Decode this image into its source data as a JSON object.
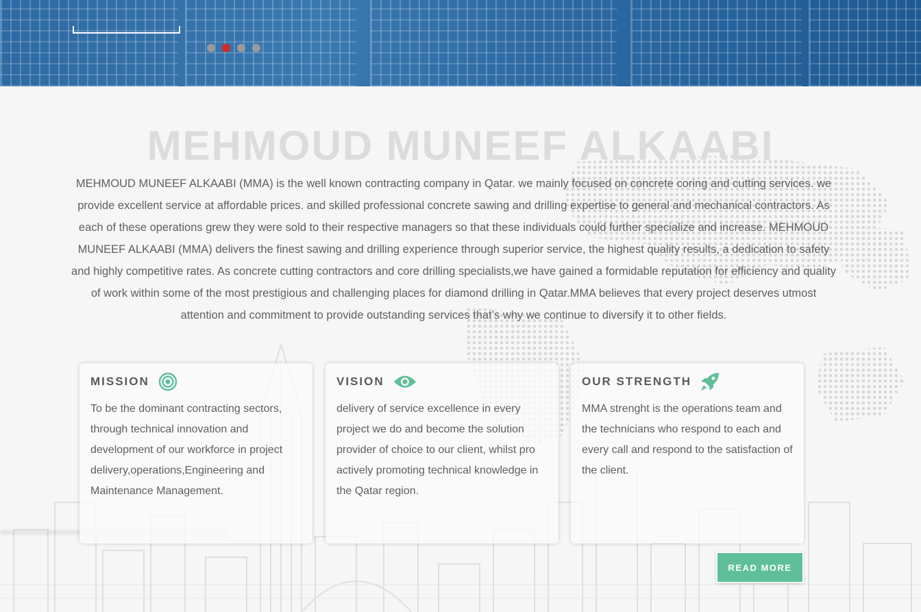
{
  "hero": {
    "slides": 4,
    "active_slide": 2
  },
  "about": {
    "title": "MEHMOUD MUNEEF ALKAABI",
    "description": "MEHMOUD MUNEEF ALKAABI (MMA) is the well known contracting company in Qatar. we mainly focused on concrete coring and cutting services. we provide excellent service at affordable prices. and skilled professional concrete sawing and drilling expertise to general and mechanical contractors. As each of these operations grew they were sold to their respective managers so that these individuals could further specialize and increase. MEHMOUD MUNEEF ALKAABI (MMA) delivers the finest sawing and drilling experience through superior service, the highest quality results, a dedication to safety and highly competitive rates. As concrete cutting contractors and core drilling specialists,we have gained a formidable reputation for efficiency and quality of work within some of the most prestigious and challenging places for diamond drilling in Qatar.MMA believes that every project deserves utmost attention and commitment to provide outstanding services that’s why we continue to diversify it to other fields."
  },
  "cards": {
    "mission": {
      "title": "MISSION",
      "icon": "target-icon",
      "text": "To be the dominant contracting sectors, through technical innovation and development of our workforce in project delivery,operations,Engineering and Maintenance Management."
    },
    "vision": {
      "title": "VISION",
      "icon": "eye-icon",
      "text": "delivery of service excellence in every project we do and become the solution provider of choice to our client, whilst pro actively promoting technical knowledge in the Qatar region."
    },
    "strength": {
      "title": "OUR STRENGTH",
      "icon": "rocket-icon",
      "text": "MMA strenght is the operations team and the technicians who respond to each and every call and respond to the satisfaction of the client."
    }
  },
  "read_more_label": "READ MORE",
  "colors": {
    "accent": "#5fbf9b",
    "hero_blue": "#2e6aa3",
    "active_dot": "#d62b2b",
    "inactive_dot": "#9a9a9a"
  }
}
